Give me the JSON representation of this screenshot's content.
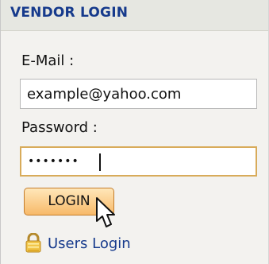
{
  "panel": {
    "title": "VENDOR LOGIN"
  },
  "form": {
    "email_label": "E-Mail :",
    "email_value": "example@yahoo.com",
    "password_label": "Password :",
    "password_value": "•••••••",
    "login_label": "LOGIN"
  },
  "footer": {
    "users_login_label": "Users Login",
    "icon": "lock-icon"
  },
  "colors": {
    "title": "#163a8c",
    "link": "#163a8c",
    "button_border": "#c47c2a",
    "password_focus_border": "#d8ab5a"
  }
}
